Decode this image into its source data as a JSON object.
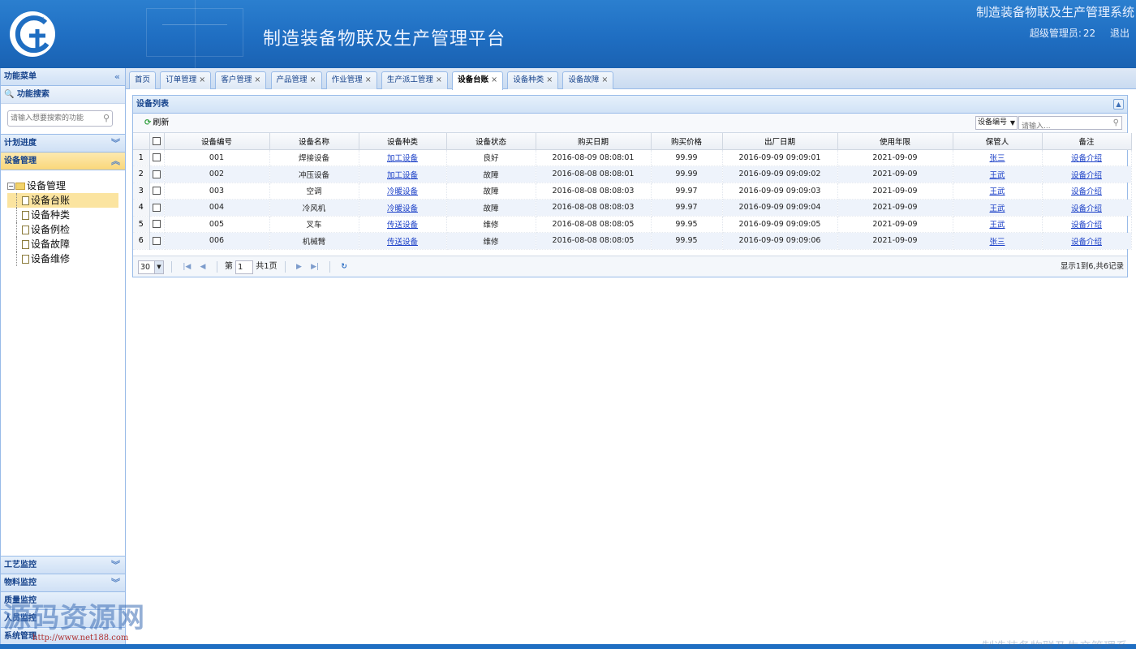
{
  "header": {
    "platform_title": "制造装备物联及生产管理平台",
    "system_name": "制造装备物联及生产管理系统",
    "user_label": "超级管理员:",
    "user_id": "22",
    "logout": "退出",
    "logo_text": "GT"
  },
  "sidebar": {
    "title": "功能菜单",
    "search_label": "功能搜索",
    "search_placeholder": "请输入想要搜索的功能",
    "sections": [
      {
        "label": "计划进度"
      },
      {
        "label": "设备管理"
      },
      {
        "label": "工艺监控"
      },
      {
        "label": "物料监控"
      },
      {
        "label": "质量监控"
      },
      {
        "label": "人员监控"
      },
      {
        "label": "系统管理"
      }
    ],
    "tree": {
      "root": "设备管理",
      "children": [
        "设备台账",
        "设备种类",
        "设备例检",
        "设备故障",
        "设备维修"
      ]
    }
  },
  "tabs": [
    {
      "label": "首页"
    },
    {
      "label": "订单管理"
    },
    {
      "label": "客户管理"
    },
    {
      "label": "产品管理"
    },
    {
      "label": "作业管理"
    },
    {
      "label": "生产派工管理"
    },
    {
      "label": "设备台账"
    },
    {
      "label": "设备种类"
    },
    {
      "label": "设备故障"
    }
  ],
  "panel": {
    "title": "设备列表",
    "refresh": "刷新",
    "search_field": "设备编号",
    "search_placeholder": "请输入..."
  },
  "table": {
    "columns": [
      "设备编号",
      "设备名称",
      "设备种类",
      "设备状态",
      "购买日期",
      "购买价格",
      "出厂日期",
      "使用年限",
      "保管人",
      "备注"
    ],
    "rows": [
      {
        "n": "1",
        "id": "001",
        "name": "焊接设备",
        "kind": "加工设备",
        "status": "良好",
        "buy": "2016-08-09 08:08:01",
        "price": "99.99",
        "out": "2016-09-09 09:09:01",
        "life": "2021-09-09",
        "keeper": "张三",
        "note": "设备介绍"
      },
      {
        "n": "2",
        "id": "002",
        "name": "冲压设备",
        "kind": "加工设备",
        "status": "故障",
        "buy": "2016-08-08 08:08:01",
        "price": "99.99",
        "out": "2016-09-09 09:09:02",
        "life": "2021-09-09",
        "keeper": "王武",
        "note": "设备介绍"
      },
      {
        "n": "3",
        "id": "003",
        "name": "空调",
        "kind": "冷暖设备",
        "status": "故障",
        "buy": "2016-08-08 08:08:03",
        "price": "99.97",
        "out": "2016-09-09 09:09:03",
        "life": "2021-09-09",
        "keeper": "王武",
        "note": "设备介绍"
      },
      {
        "n": "4",
        "id": "004",
        "name": "冷风机",
        "kind": "冷暖设备",
        "status": "故障",
        "buy": "2016-08-08 08:08:03",
        "price": "99.97",
        "out": "2016-09-09 09:09:04",
        "life": "2021-09-09",
        "keeper": "王武",
        "note": "设备介绍"
      },
      {
        "n": "5",
        "id": "005",
        "name": "叉车",
        "kind": "传送设备",
        "status": "维修",
        "buy": "2016-08-08 08:08:05",
        "price": "99.95",
        "out": "2016-09-09 09:09:05",
        "life": "2021-09-09",
        "keeper": "王武",
        "note": "设备介绍"
      },
      {
        "n": "6",
        "id": "006",
        "name": "机械臂",
        "kind": "传送设备",
        "status": "维修",
        "buy": "2016-08-08 08:08:05",
        "price": "99.95",
        "out": "2016-09-09 09:09:06",
        "life": "2021-09-09",
        "keeper": "张三",
        "note": "设备介绍"
      }
    ]
  },
  "pager": {
    "page_size": "30",
    "page_prefix": "第",
    "page_value": "1",
    "page_total": "共1页",
    "info": "显示1到6,共6记录"
  },
  "watermark": {
    "text": "源码资源网",
    "url": "http://www.net188.com",
    "bottom_ghost": "制造装备物联及生产管理系"
  }
}
